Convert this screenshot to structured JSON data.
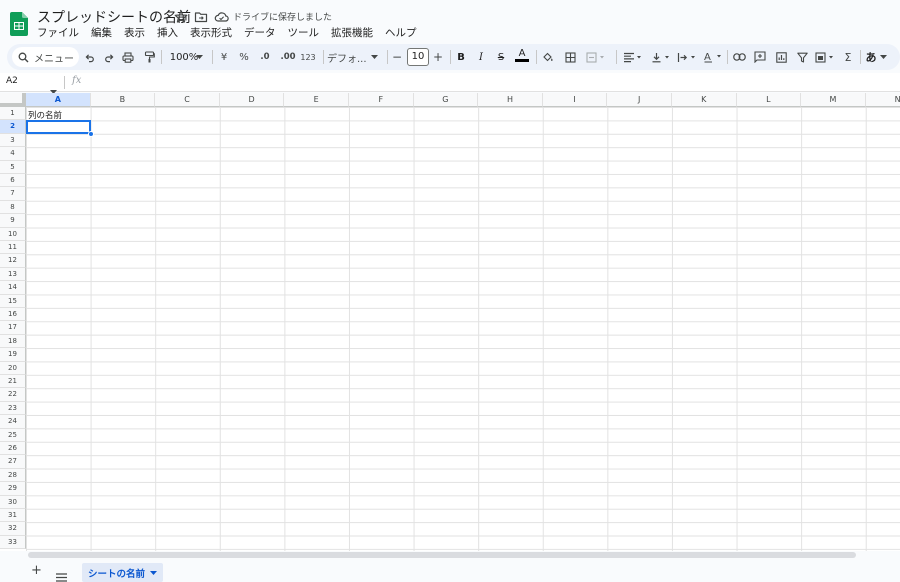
{
  "header": {
    "title": "スプレッドシートの名前",
    "drive_status": "ドライブに保存しました",
    "icons": [
      "sheets-logo-icon",
      "star-icon",
      "move-folder-icon",
      "cloud-saved-icon"
    ],
    "brand_color": "#0f9d58"
  },
  "menubar": {
    "items": [
      "ファイル",
      "編集",
      "表示",
      "挿入",
      "表示形式",
      "データ",
      "ツール",
      "拡張機能",
      "ヘルプ"
    ]
  },
  "toolbar": {
    "search_label": "メニュー",
    "zoom": "100%",
    "currency": "¥",
    "percent": "%",
    "dec_decrease": ".0",
    "dec_increase": ".00",
    "number_format": "123",
    "font": "デフォ...",
    "font_size": "10",
    "minus": "−",
    "plus": "+",
    "bold": "B",
    "italic": "I",
    "strike": "S",
    "text_color": "A",
    "ime": "あ",
    "sigma": "Σ"
  },
  "formula_bar": {
    "name_box": "A2",
    "fx": "fx"
  },
  "grid": {
    "columns": [
      "A",
      "B",
      "C",
      "D",
      "E",
      "F",
      "G",
      "H",
      "I",
      "J",
      "K",
      "L",
      "M",
      "N"
    ],
    "active_column": "A",
    "rows": [
      "1",
      "2",
      "3",
      "4",
      "5",
      "6",
      "7",
      "8",
      "9",
      "10",
      "11",
      "12",
      "13",
      "14",
      "15",
      "16",
      "17",
      "18",
      "19",
      "20",
      "21",
      "22",
      "23",
      "24",
      "25",
      "26",
      "27",
      "28",
      "29",
      "30",
      "31",
      "32",
      "33"
    ],
    "active_row": "2",
    "cell_a1": "列の名前",
    "selection_color": "#1a73e8"
  },
  "sheets": {
    "tabs": [
      "シートの名前"
    ],
    "active": "シートの名前"
  }
}
